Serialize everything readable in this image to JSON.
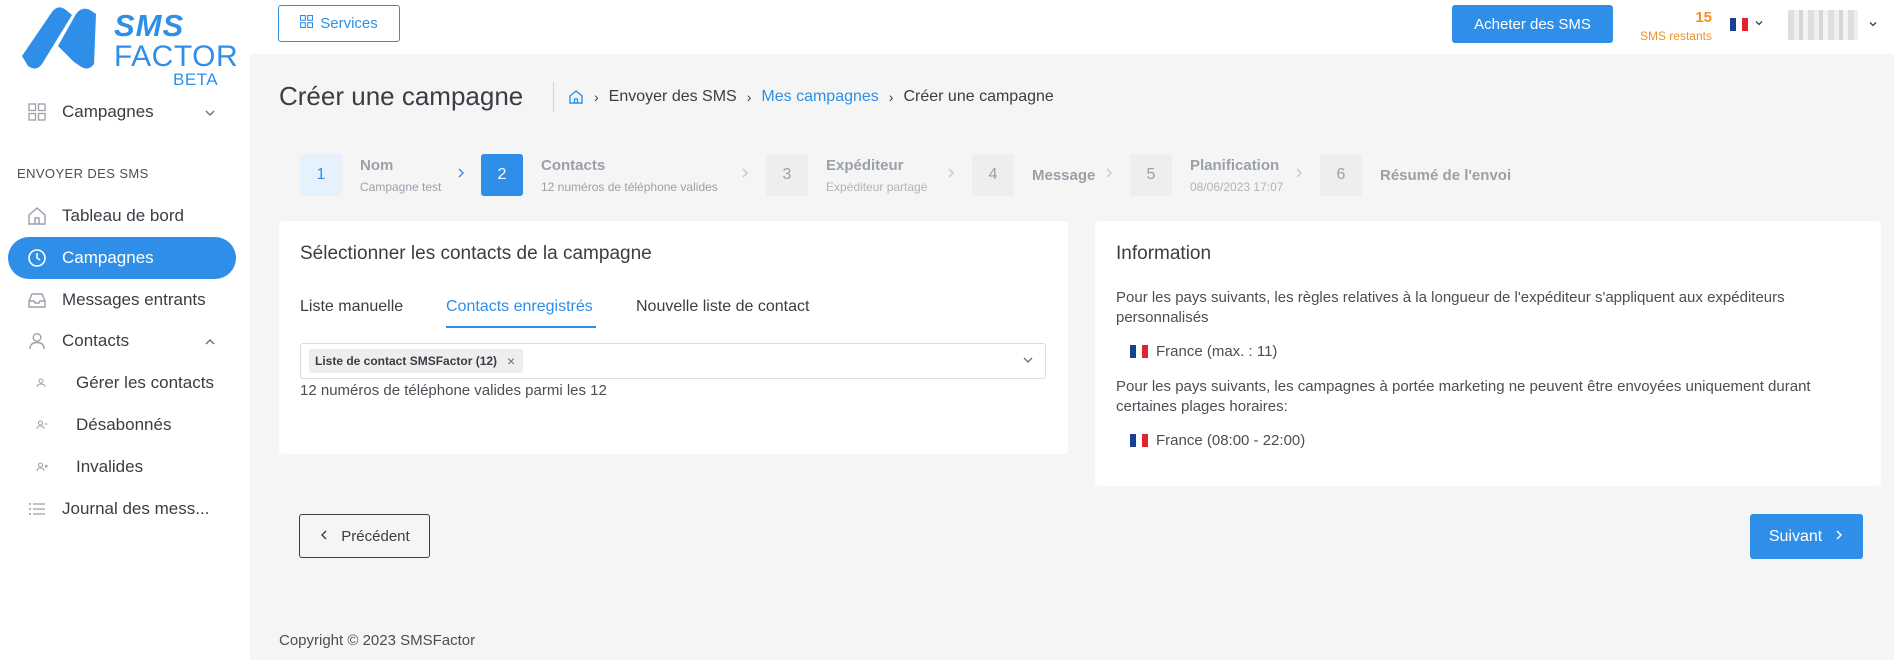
{
  "brand": {
    "line1": "SMS",
    "line2": "FACTOR",
    "badge": "BETA",
    "color": "#2f8fe8"
  },
  "sidebar": {
    "top_item": "Campagnes",
    "section_label": "ENVOYER DES SMS",
    "items": [
      {
        "label": "Tableau de bord",
        "icon": "home-icon"
      },
      {
        "label": "Campagnes",
        "icon": "clock-icon",
        "active": true
      },
      {
        "label": "Messages entrants",
        "icon": "inbox-icon"
      },
      {
        "label": "Contacts",
        "icon": "user-icon"
      }
    ],
    "subitems": [
      {
        "label": "Gérer les contacts",
        "icon": "users-icon"
      },
      {
        "label": "Désabonnés",
        "icon": "user-minus-icon"
      },
      {
        "label": "Invalides",
        "icon": "user-x-icon"
      }
    ],
    "journal": "Journal des mess..."
  },
  "topbar": {
    "services_label": "Services",
    "buy_label": "Acheter des SMS",
    "credits_count": "15",
    "credits_label": "SMS restants",
    "language": "fr"
  },
  "page": {
    "title": "Créer une campagne",
    "breadcrumb": [
      "Envoyer des SMS",
      "Mes campagnes",
      "Créer une campagne"
    ]
  },
  "steps": [
    {
      "num": "1",
      "title": "Nom",
      "subtitle": "Campagne test",
      "state": "done"
    },
    {
      "num": "2",
      "title": "Contacts",
      "subtitle": "12 numéros de téléphone valides",
      "state": "current"
    },
    {
      "num": "3",
      "title": "Expéditeur",
      "subtitle": "Expéditeur partagé",
      "state": "todo"
    },
    {
      "num": "4",
      "title": "Message",
      "subtitle": "",
      "state": "todo"
    },
    {
      "num": "5",
      "title": "Planification",
      "subtitle": "08/06/2023 17:07",
      "state": "todo"
    },
    {
      "num": "6",
      "title": "Résumé de l'envoi",
      "subtitle": "",
      "state": "todo"
    }
  ],
  "contacts_card": {
    "title": "Sélectionner les contacts de la campagne",
    "tabs": [
      "Liste manuelle",
      "Contacts enregistrés",
      "Nouvelle liste de contact"
    ],
    "active_tab": 1,
    "selected_chip": "Liste de contact SMSFactor (12)",
    "help": "12 numéros de téléphone valides parmi les 12"
  },
  "info_card": {
    "title": "Information",
    "para1": "Pour les pays suivants, les règles relatives à la longueur de l'expéditeur s'appliquent aux expéditeurs personnalisés",
    "country1": "France (max. : 11)",
    "para2": "Pour les pays suivants, les campagnes à portée marketing ne peuvent être envoyées uniquement durant certaines plages horaires:",
    "country2": "France (08:00 - 22:00)"
  },
  "actions": {
    "prev": "Précédent",
    "next": "Suivant"
  },
  "footer": {
    "copyright": "Copyright © 2023 SMSFactor"
  }
}
